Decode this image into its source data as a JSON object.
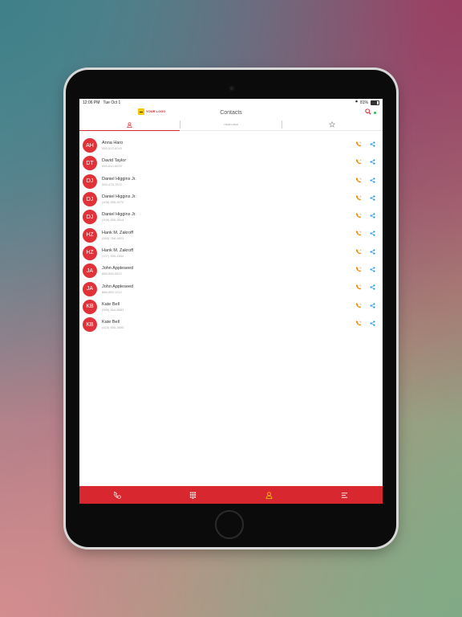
{
  "status": {
    "time": "12:06 PM",
    "date": "Tue Oct 1",
    "battery": "81%"
  },
  "header": {
    "title": "Contacts",
    "brand": "YOUR LOGO",
    "online_color": "#2ec14a"
  },
  "tabs": [
    {
      "icon": "person-icon",
      "selected": true
    },
    {
      "icon": "brand-logo-icon",
      "label": "YOUR LOGO",
      "selected": false
    },
    {
      "icon": "star-icon",
      "selected": false
    }
  ],
  "contacts": [
    {
      "initials": "AH",
      "name": "Anna Haro",
      "phone": "555-522-8243"
    },
    {
      "initials": "DT",
      "name": "David Taylor",
      "phone": "555-610-6679"
    },
    {
      "initials": "DJ",
      "name": "Daniel Higgins Jr.",
      "phone": "555-478-7672"
    },
    {
      "initials": "DJ",
      "name": "Daniel Higgins Jr.",
      "phone": "(408) 555-5270"
    },
    {
      "initials": "DJ",
      "name": "Daniel Higgins Jr.",
      "phone": "(408) 555-3514"
    },
    {
      "initials": "HZ",
      "name": "Hank M. Zakroff",
      "phone": "(555) 766-4823"
    },
    {
      "initials": "HZ",
      "name": "Hank M. Zakroff",
      "phone": "(707) 555-1854"
    },
    {
      "initials": "JA",
      "name": "John Appleseed",
      "phone": "888-555-5512"
    },
    {
      "initials": "JA",
      "name": "John Appleseed",
      "phone": "888-555-1212"
    },
    {
      "initials": "KB",
      "name": "Kate Bell",
      "phone": "(555) 564-8583"
    },
    {
      "initials": "KB",
      "name": "Kate Bell",
      "phone": "(415) 555-3695"
    }
  ],
  "bottom_nav": [
    {
      "icon": "recent-calls-icon",
      "selected": false
    },
    {
      "icon": "dialpad-icon",
      "selected": false
    },
    {
      "icon": "contacts-icon",
      "selected": true
    },
    {
      "icon": "menu-icon",
      "selected": false
    }
  ],
  "colors": {
    "accent": "#d8272e",
    "call": "#f08a00",
    "share": "#1a8fe0"
  }
}
